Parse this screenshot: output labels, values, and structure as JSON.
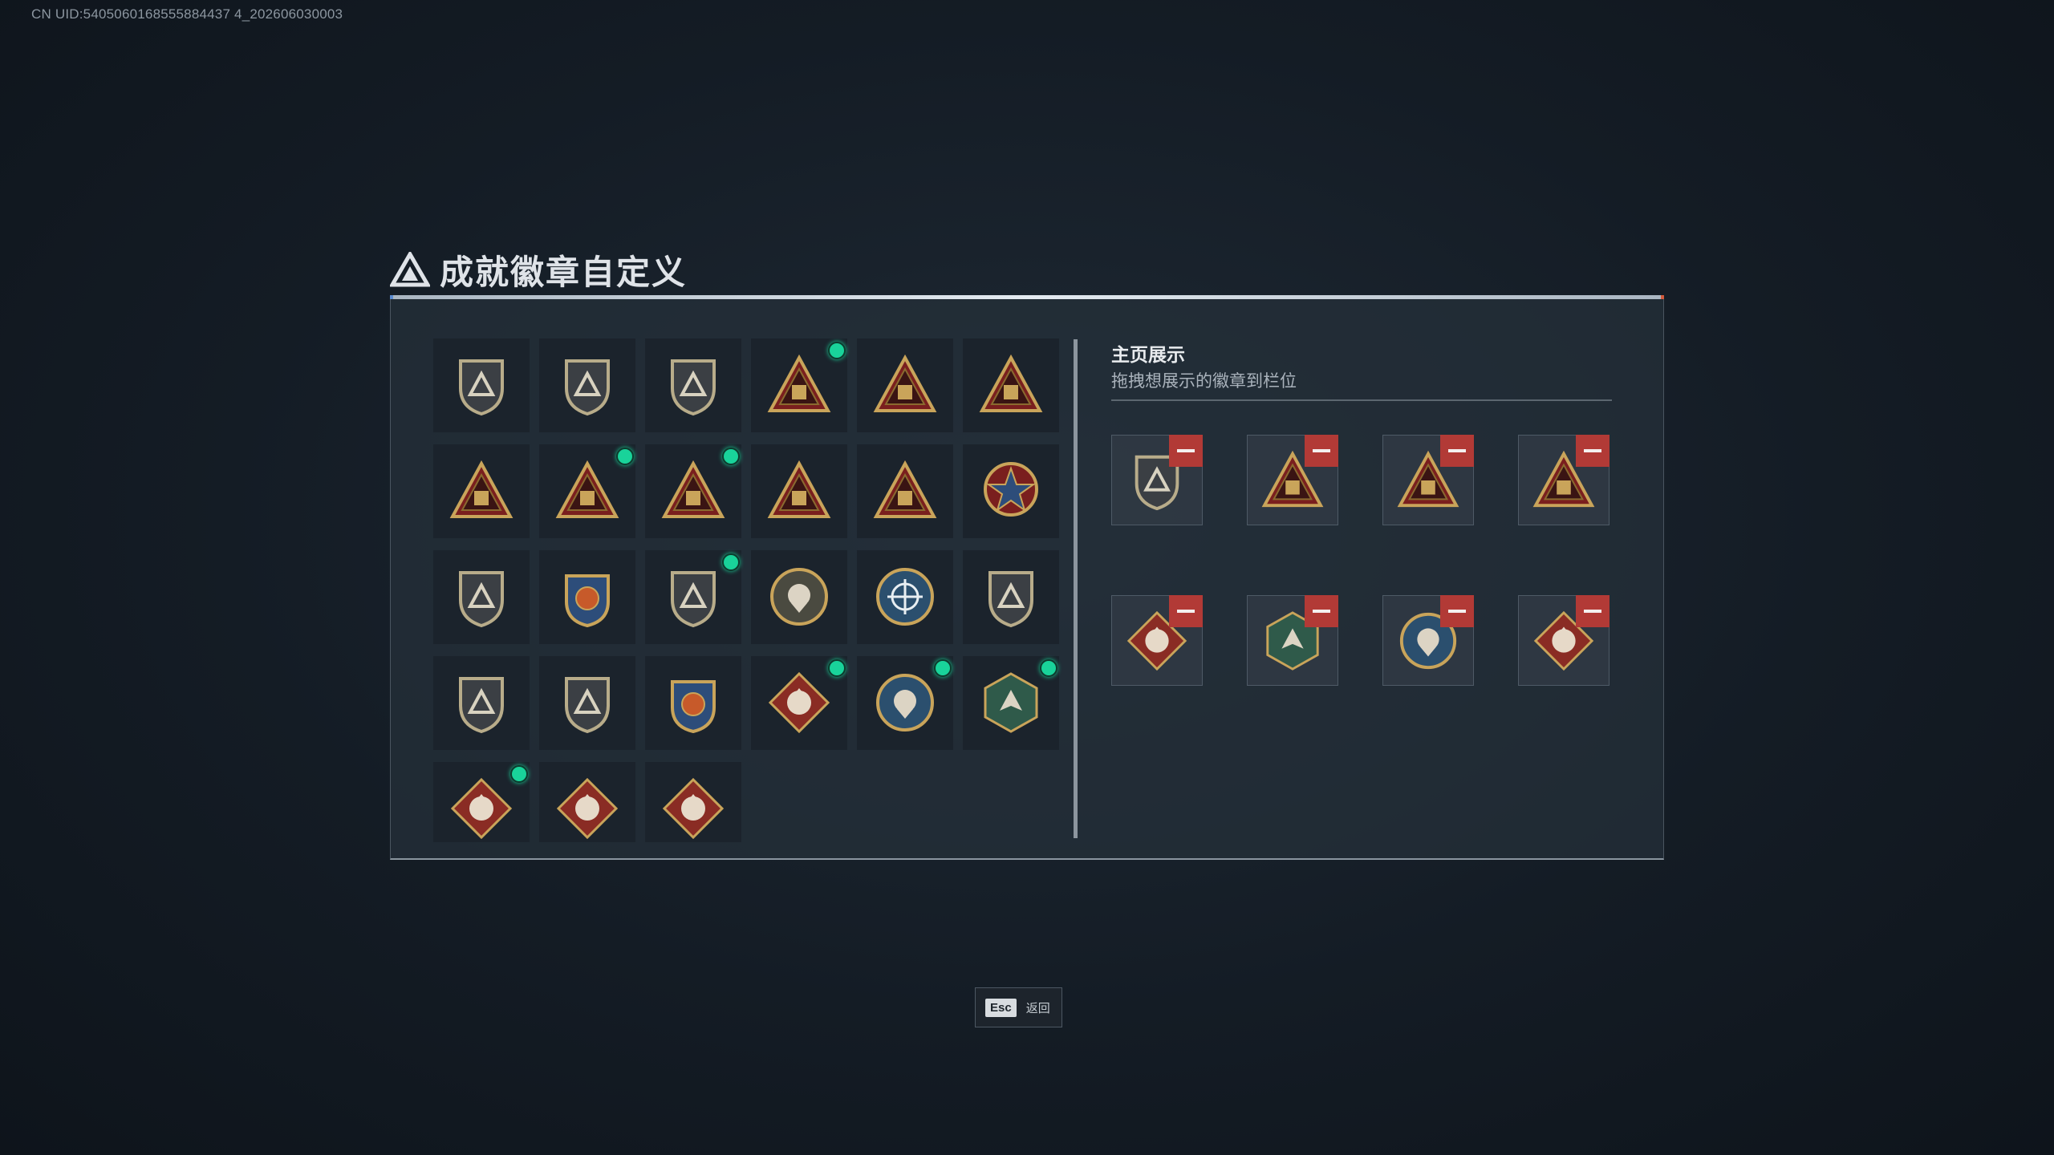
{
  "uid_text": "CN UID:5405060168555884437 4_202606030003",
  "title": "成就徽章自定义",
  "right_panel": {
    "title": "主页展示",
    "subtitle": "拖拽想展示的徽章到栏位"
  },
  "badges": [
    {
      "icon": "shield-delta-badge-icon",
      "new": false
    },
    {
      "icon": "shield-helicopter-badge-icon",
      "new": false
    },
    {
      "icon": "shield-dagger-badge-icon",
      "new": false
    },
    {
      "icon": "triangle-sb-badge-icon",
      "new": true
    },
    {
      "icon": "triangle-hand-badge-icon",
      "new": false
    },
    {
      "icon": "triangle-leaf-badge-icon",
      "new": false
    },
    {
      "icon": "triangle-number-one-badge-icon",
      "new": false
    },
    {
      "icon": "triangle-crate-badge-icon",
      "new": true
    },
    {
      "icon": "triangle-medic-badge-icon",
      "new": true
    },
    {
      "icon": "triangle-soldier-badge-icon",
      "new": false
    },
    {
      "icon": "triangle-rifle-badge-icon",
      "new": false
    },
    {
      "icon": "star-emblem-badge-icon",
      "new": false
    },
    {
      "icon": "shield-wings-badge-icon",
      "new": false
    },
    {
      "icon": "crest-stars-badge-icon",
      "new": false
    },
    {
      "icon": "shield-hexagon-badge-icon",
      "new": true
    },
    {
      "icon": "round-skull-badge-icon",
      "new": false
    },
    {
      "icon": "blue-crosshair-badge-icon",
      "new": false
    },
    {
      "icon": "shield-rifle-badge-icon",
      "new": false
    },
    {
      "icon": "shield-rifle-badge-icon",
      "new": false
    },
    {
      "icon": "shield-rifle-badge-icon",
      "new": false
    },
    {
      "icon": "blue-gold-crest-badge-icon",
      "new": false
    },
    {
      "icon": "diamond-wolf-badge-icon",
      "new": true
    },
    {
      "icon": "round-eagle-badge-icon",
      "new": true
    },
    {
      "icon": "hex-green-beast-badge-icon",
      "new": true
    },
    {
      "icon": "diamond-dragon-badge-icon",
      "new": true
    },
    {
      "icon": "diamond-horse-badge-icon",
      "new": false
    },
    {
      "icon": "diamond-hammer-badge-icon",
      "new": false
    }
  ],
  "display_slots": [
    {
      "icon": "shield-hexagon-badge-icon"
    },
    {
      "icon": "triangle-sb-badge-icon"
    },
    {
      "icon": "triangle-crate-badge-icon"
    },
    {
      "icon": "triangle-medic-badge-icon"
    },
    {
      "icon": "diamond-wolf-badge-icon"
    },
    {
      "icon": "hex-green-beast-badge-icon"
    },
    {
      "icon": "round-eagle-badge-icon"
    },
    {
      "icon": "diamond-dragon-badge-icon"
    }
  ],
  "esc": {
    "key": "Esc",
    "label": "返回"
  },
  "colors": {
    "new_indicator": "#19d39a",
    "remove_button": "#b23a36",
    "gold": "#c9a45a"
  }
}
